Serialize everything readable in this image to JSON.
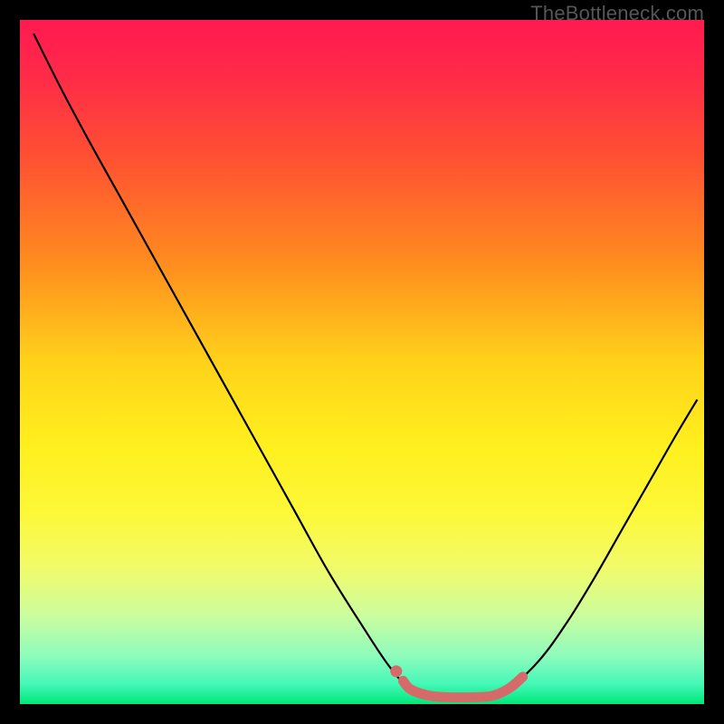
{
  "watermark": "TheBottleneck.com",
  "chart_data": {
    "type": "line",
    "title": "",
    "xlabel": "",
    "ylabel": "",
    "xlim": [
      0,
      100
    ],
    "ylim": [
      0,
      100
    ],
    "gradient_stops": [
      {
        "offset": 0.0,
        "color": "#ff1a50"
      },
      {
        "offset": 0.08,
        "color": "#ff2a48"
      },
      {
        "offset": 0.2,
        "color": "#ff5033"
      },
      {
        "offset": 0.35,
        "color": "#ff8a1f"
      },
      {
        "offset": 0.5,
        "color": "#ffd21a"
      },
      {
        "offset": 0.62,
        "color": "#ffef1e"
      },
      {
        "offset": 0.72,
        "color": "#fdf838"
      },
      {
        "offset": 0.8,
        "color": "#f2fb6a"
      },
      {
        "offset": 0.87,
        "color": "#ccfd9e"
      },
      {
        "offset": 0.93,
        "color": "#8dfcbd"
      },
      {
        "offset": 0.97,
        "color": "#45f8b8"
      },
      {
        "offset": 1.0,
        "color": "#00e878"
      }
    ],
    "series": [
      {
        "name": "bottleneck-curve",
        "color": "#000000",
        "points": [
          {
            "x": 2.0,
            "y": 98.0
          },
          {
            "x": 6.0,
            "y": 90.0
          },
          {
            "x": 10.0,
            "y": 82.5
          },
          {
            "x": 15.0,
            "y": 73.5
          },
          {
            "x": 20.0,
            "y": 64.5
          },
          {
            "x": 25.0,
            "y": 55.5
          },
          {
            "x": 30.0,
            "y": 46.5
          },
          {
            "x": 35.0,
            "y": 37.5
          },
          {
            "x": 40.0,
            "y": 28.5
          },
          {
            "x": 45.0,
            "y": 19.5
          },
          {
            "x": 50.0,
            "y": 11.5
          },
          {
            "x": 54.0,
            "y": 5.5
          },
          {
            "x": 57.0,
            "y": 2.3
          },
          {
            "x": 60.0,
            "y": 1.2
          },
          {
            "x": 63.0,
            "y": 1.0
          },
          {
            "x": 66.0,
            "y": 1.0
          },
          {
            "x": 69.0,
            "y": 1.2
          },
          {
            "x": 72.0,
            "y": 2.7
          },
          {
            "x": 76.0,
            "y": 6.5
          },
          {
            "x": 80.0,
            "y": 12.0
          },
          {
            "x": 84.0,
            "y": 18.5
          },
          {
            "x": 88.0,
            "y": 25.5
          },
          {
            "x": 92.0,
            "y": 32.5
          },
          {
            "x": 96.0,
            "y": 39.5
          },
          {
            "x": 99.0,
            "y": 44.5
          }
        ]
      },
      {
        "name": "highlighted-segment",
        "color": "#d66a6a",
        "points": [
          {
            "x": 56.0,
            "y": 3.4
          },
          {
            "x": 57.2,
            "y": 2.1
          },
          {
            "x": 60.0,
            "y": 1.2
          },
          {
            "x": 63.0,
            "y": 1.0
          },
          {
            "x": 66.0,
            "y": 1.0
          },
          {
            "x": 69.0,
            "y": 1.2
          },
          {
            "x": 71.5,
            "y": 2.3
          },
          {
            "x": 73.5,
            "y": 4.0
          }
        ],
        "detached_dot": {
          "x": 55.0,
          "y": 4.8
        }
      }
    ]
  }
}
